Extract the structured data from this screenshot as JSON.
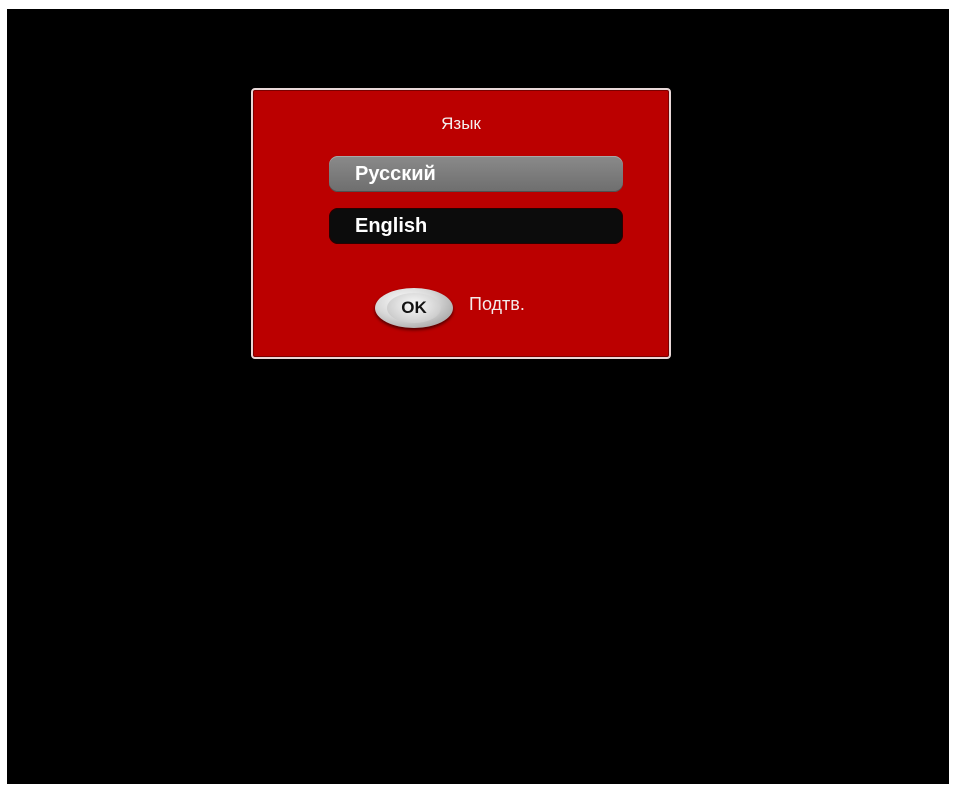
{
  "dialog": {
    "title": "Язык",
    "options": [
      {
        "label": "Русский",
        "selected": true
      },
      {
        "label": "English",
        "selected": false
      }
    ],
    "ok_button_label": "OK",
    "ok_hint": "Подтв."
  },
  "colors": {
    "background": "#000000",
    "dialog_bg": "#bb0000",
    "selected_option_bg": "#7a7a7a",
    "option_bg": "#0c0c0c"
  }
}
